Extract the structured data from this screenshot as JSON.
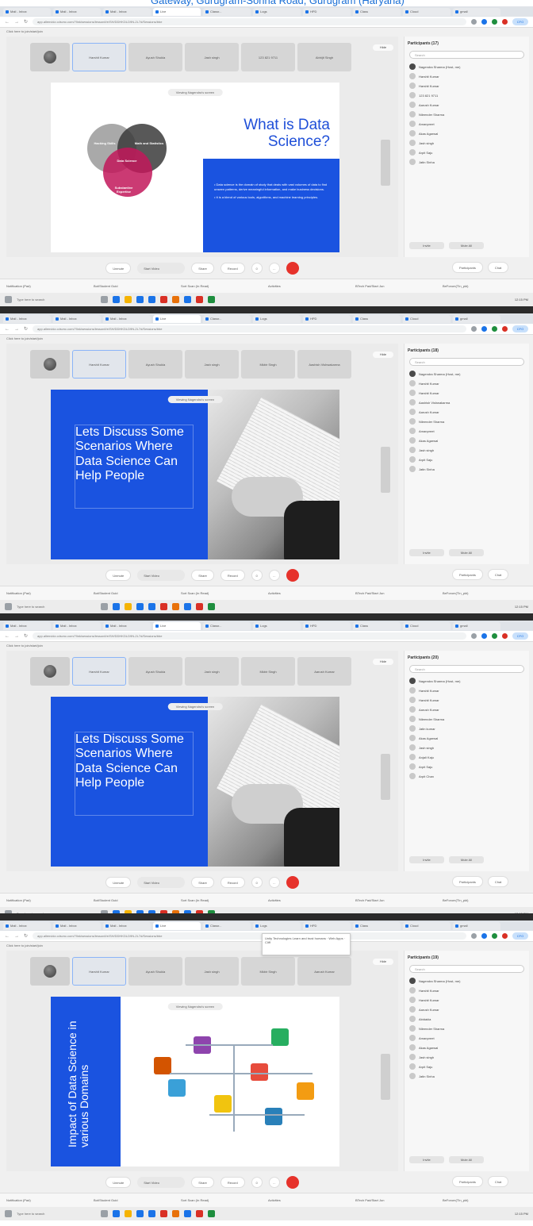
{
  "top_caption": "Gateway, Gurugram-Sohna Road, Gurugram (Haryana)",
  "colors": {
    "accent": "#1a53e0",
    "end_call": "#e6322b"
  },
  "browser": {
    "url": "app.allenvidz.cdsvnc.com/?link/sessions/lesson/t/e/SH/DDHKDLD9N-2L7d/Sessions/bbe",
    "bookmark": "Click here to join/start/join",
    "tabs": [
      "Mail - Inbox",
      "Mail - Inbox",
      "Mail - Inbox",
      "Live",
      "Classr...",
      "Logs",
      "HPD",
      "Class",
      "Cloud",
      "gmail"
    ]
  },
  "meeting": {
    "hide_label": "Hide",
    "controls": {
      "unmute": "Unmute",
      "start_video": "Start Video",
      "share": "Share",
      "record": "Record",
      "more": "..."
    },
    "tray": [
      "Notification (Pad)",
      "Bot/Student Guid",
      "Sort Scan (In Read)",
      "Activities",
      "BTech Pad/Start Jun",
      "BeForum(TIn_pkt)"
    ],
    "taskbar_search": "Type here to search",
    "clock": "12:15 PM"
  },
  "shots": [
    {
      "tiles": [
        "Harshit Kumar",
        "Ayush Shukla",
        "Jash singh",
        "123 821 9711",
        "Abhijit Singh"
      ],
      "participants_title": "Participants (17)",
      "participants": [
        "Nagendra Sharma (Host, me)",
        "Harshit Kumar",
        "Harshit Kumar",
        "123 821 9711",
        "Aarush Kumar",
        "Nileender Sharma",
        "Amanpreet",
        "Akas Agarwal",
        "Jash singh",
        "Arpit Saju",
        "Jatin Sinha"
      ],
      "slide": {
        "kind": "venn",
        "recording": "Viewing Nagendra's screen",
        "title": "What is Data Science?",
        "venn_labels": [
          "Hacking Skills",
          "Math and Statistics",
          "Data Science",
          "Substantive Expertise"
        ],
        "bullets": [
          "Data science is the domain of study that deals with vast volumes of data to find unseen patterns, derive meaningful information, and make business decisions.",
          "It is a blend of various tools, algorithms, and machine learning principles."
        ]
      }
    },
    {
      "tiles": [
        "Harshit Kumar",
        "Ayush Shukla",
        "Jash singh",
        "Mkbir Singh",
        "Aashish Vishwakarma"
      ],
      "participants_title": "Participants (18)",
      "participants": [
        "Nagendra Sharma (Host, me)",
        "Harshit Kumar",
        "Harshit Kumar",
        "Aashish Vishwakarma",
        "Aarush Kumar",
        "Nileender Sharma",
        "Amanpreet",
        "Akas Agarwal",
        "Jash singh",
        "Arpit Saju",
        "Jatin Sinha"
      ],
      "slide": {
        "kind": "discuss",
        "recording": "Viewing Nagendra's screen",
        "title": "Lets Discuss Some Scenarios Where Data Science Can Help People"
      }
    },
    {
      "tiles": [
        "Harshit Kumar",
        "Ayush Shukla",
        "Jash singh",
        "Mkbir Singh",
        "Aarush Kumar"
      ],
      "participants_title": "Participants (20)",
      "participants": [
        "Nagendra Sharma (Host, me)",
        "Harshit Kumar",
        "Harshit Kumar",
        "Aarush Kumar",
        "Nileender Sharma",
        "Jatin kumar",
        "Akas Agarwal",
        "Jash singh",
        "Anjali Kaju",
        "Arpit Saju",
        "Arpit Chan"
      ],
      "slide": {
        "kind": "discuss",
        "recording": "Viewing Nagendra's screen",
        "title": "Lets Discuss Some Scenarios Where Data Science Can Help People"
      }
    },
    {
      "tiles": [
        "Harshit Kumar",
        "Ayush Shukla",
        "Jash singh",
        "Mkbir Singh",
        "Aarush Kumar"
      ],
      "participants_title": "Participants (19)",
      "participants": [
        "Nagendra Sharma (Host, me)",
        "Harshit Kumar",
        "Harshit Kumar",
        "Aarush Kumar",
        "Abidakla",
        "Nileender Sharma",
        "Amanpreet",
        "Akas Agarwal",
        "Jash singh",
        "Arpit Saju",
        "Jatin Sinha"
      ],
      "slide": {
        "kind": "impact",
        "recording": "Viewing Nagendra's screen",
        "title": "Impact of Data Science in various Domains",
        "tooltip": "Unity Technologies Learn and trust humans · Web Apps · Cliff"
      }
    }
  ],
  "panel": {
    "search_placeholder": "Search",
    "invite": "Invite",
    "mute_all": "Mute All",
    "participants_btn": "Participants",
    "chat_btn": "Chat"
  }
}
